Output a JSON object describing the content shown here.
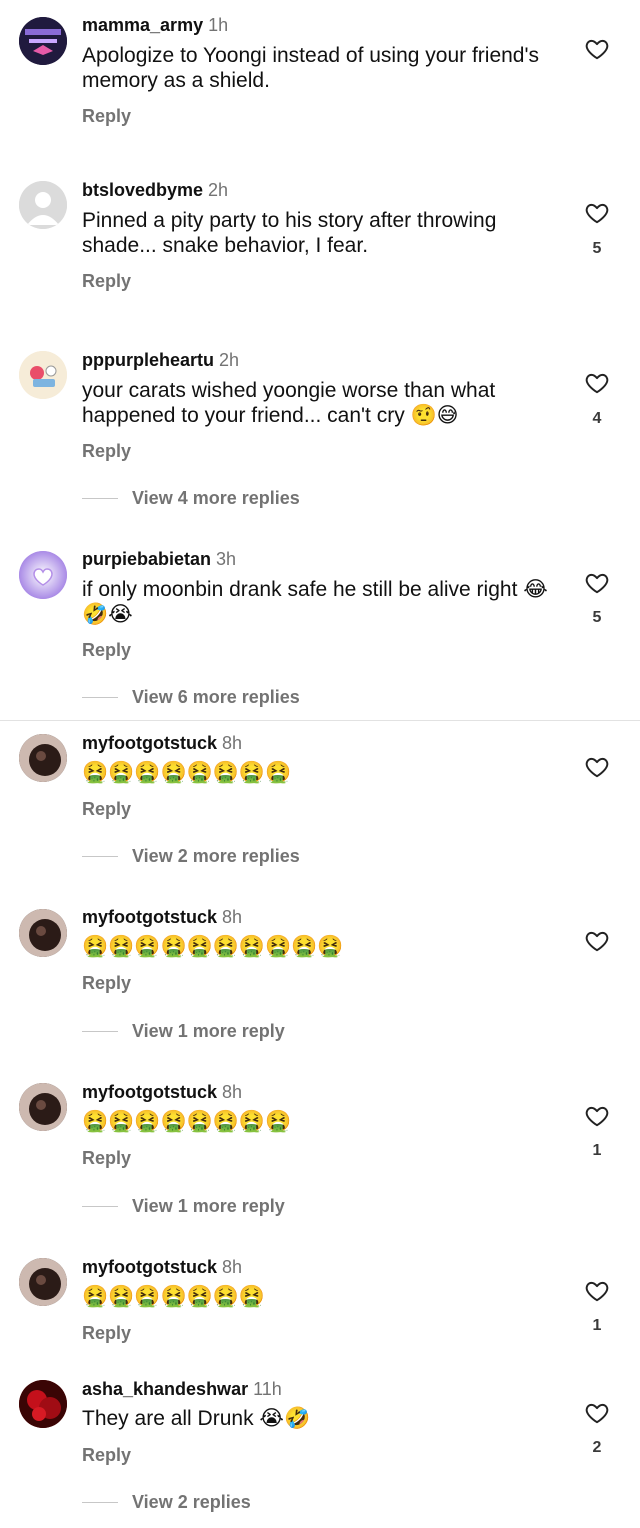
{
  "comments": [
    {
      "username": "mamma_army",
      "time": "1h",
      "text": "Apologize to Yoongi instead of using your friend's memory as a shield.",
      "reply": "Reply",
      "likes": "",
      "more": ""
    },
    {
      "username": "btslovedbyme",
      "time": "2h",
      "text": "Pinned a pity party to his story after throwing shade... snake behavior, I fear.",
      "reply": "Reply",
      "likes": "5",
      "more": ""
    },
    {
      "username": "pppurpleheartu",
      "time": "2h",
      "text": "your carats wished yoongie worse than what happened to your friend... can't cry 🤨😅",
      "reply": "Reply",
      "likes": "4",
      "more": "View 4 more replies"
    },
    {
      "username": "purpiebabietan",
      "time": "3h",
      "text": "if only moonbin drank safe he still be alive right 😂🤣😭",
      "reply": "Reply",
      "likes": "5",
      "more": "View 6 more replies"
    },
    {
      "username": "myfootgotstuck",
      "time": "8h",
      "text": "🤮🤮🤮🤮🤮🤮🤮🤮",
      "reply": "Reply",
      "likes": "",
      "more": "View 2 more replies"
    },
    {
      "username": "myfootgotstuck",
      "time": "8h",
      "text": "🤮🤮🤮🤮🤮🤮🤮🤮🤮🤮",
      "reply": "Reply",
      "likes": "",
      "more": "View 1 more reply"
    },
    {
      "username": "myfootgotstuck",
      "time": "8h",
      "text": "🤮🤮🤮🤮🤮🤮🤮🤮",
      "reply": "Reply",
      "likes": "1",
      "more": "View 1 more reply"
    },
    {
      "username": "myfootgotstuck",
      "time": "8h",
      "text": "🤮🤮🤮🤮🤮🤮🤮",
      "reply": "Reply",
      "likes": "1",
      "more": ""
    },
    {
      "username": "asha_khandeshwar",
      "time": "11h",
      "text": "They are all Drunk 😭🤣",
      "reply": "Reply",
      "likes": "2",
      "more": "View 2 replies"
    }
  ],
  "icons": {
    "like": "heart-outline-icon"
  },
  "colors": {
    "secondary_text": "#737373",
    "divider": "#e2e2e2",
    "text": "#111111"
  }
}
